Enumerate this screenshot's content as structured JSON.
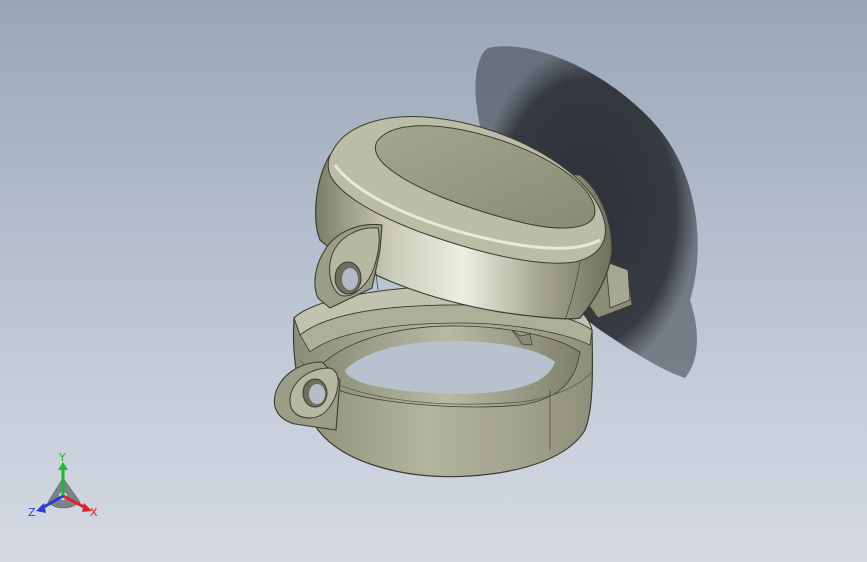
{
  "viewport": {
    "background_top": "#9aa6b6",
    "background_bottom": "#d4d9e2",
    "model_color": "#a3a48e",
    "shadow_color": "#2a2e34"
  },
  "triad": {
    "x_label": "X",
    "y_label": "Y",
    "z_label": "Z",
    "x_color": "#d8262a",
    "y_color": "#1fb832",
    "z_color": "#2a3fd0"
  }
}
